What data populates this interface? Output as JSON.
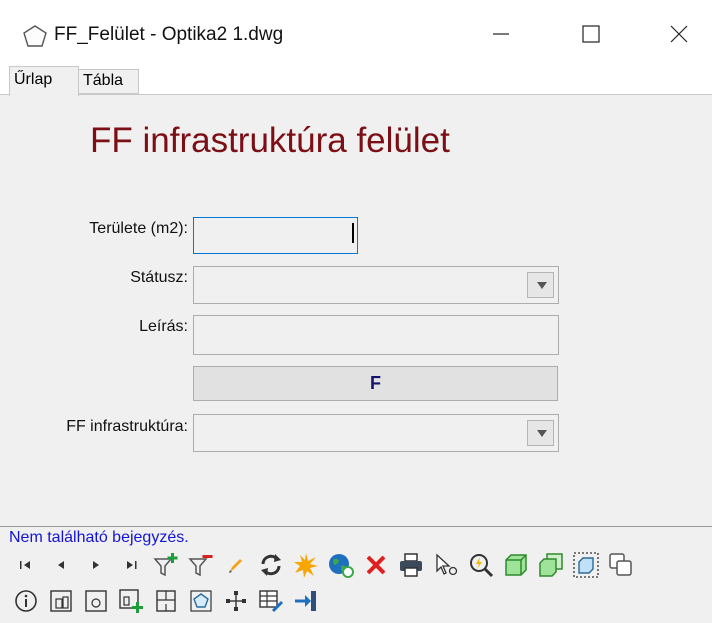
{
  "window": {
    "title": "FF_Felület - Optika2 1.dwg",
    "icon": "pentagon-icon",
    "controls": [
      "minimize-icon",
      "maximize-icon",
      "close-icon"
    ]
  },
  "tabs": [
    {
      "label": "Űrlap",
      "active": true
    },
    {
      "label": "Tábla",
      "active": false
    }
  ],
  "form": {
    "title": "FF infrastruktúra felület",
    "title_color": "#7b0f15",
    "fields": {
      "area": {
        "label": "Területe (m2):",
        "value": ""
      },
      "status": {
        "label": "Státusz:",
        "value": ""
      },
      "description": {
        "label": "Leírás:",
        "value": ""
      },
      "infrastructure": {
        "label": "FF infrastruktúra:",
        "value": ""
      }
    },
    "f_button_label": "F"
  },
  "status": {
    "message": "Nem található bejegyzés.",
    "message_color": "#1414d6"
  },
  "toolbar": {
    "row1": [
      "first-record-icon",
      "previous-record-icon",
      "next-record-icon",
      "last-record-icon",
      "add-filter-icon",
      "remove-filter-icon",
      "edit-pencil-icon",
      "refresh-icon",
      "highlight-star-icon",
      "globe-link-icon",
      "delete-icon",
      "print-icon",
      "select-pointer-icon",
      "zoom-to-icon",
      "solid-3d-icon",
      "duplicate-3d-icon",
      "dashed-3d-icon",
      "overlap-icon"
    ],
    "row2": [
      "info-icon",
      "area-measure-icon",
      "object-icon",
      "add-area-icon",
      "floorplan-icon",
      "pentagon-select-icon",
      "network-icon",
      "table-edit-icon",
      "exit-icon"
    ]
  }
}
